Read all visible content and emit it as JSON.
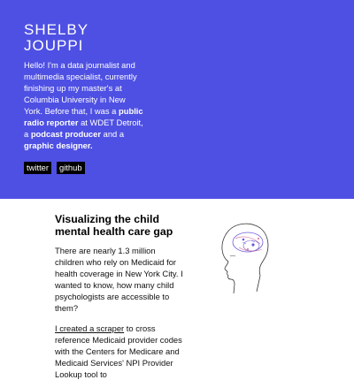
{
  "header": {
    "name_line1": "SHELBY",
    "name_line2": "JOUPPI",
    "bio": {
      "part1": "Hello! I'm a data journalist and multimedia specialist, currently finishing up my master's at Columbia University in New York. Before that, I was a ",
      "role1": "public radio reporter",
      "part2": " at WDET Detroit, a ",
      "role2": "podcast producer",
      "part3": " and a ",
      "role3": "graphic designer."
    },
    "links": {
      "twitter": "twitter",
      "github": "github"
    }
  },
  "project": {
    "title": "Visualizing the child mental health care gap",
    "description": "There are nearly 1.3 million children who rely on Medicaid for health coverage in New York City. I wanted to know, how many child psychologists are accessible to them?",
    "link_text": "I created a scraper",
    "more_text": " to cross reference Medicaid provider codes with the Centers for Medicare and Medicaid Services' NPI Provider Lookup tool to",
    "illustration_icon": "head-with-brain-map-icon"
  },
  "colors": {
    "hero_background": "#4e50e3",
    "text_light": "#ffffff",
    "link_background": "#000000",
    "illustration_purple": "#6a5ad8",
    "illustration_pink": "#d86a9a"
  }
}
